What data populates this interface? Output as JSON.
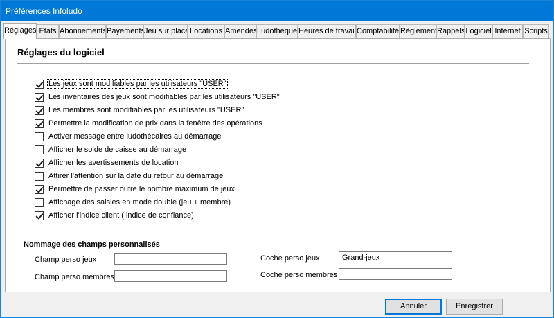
{
  "window": {
    "title": "Préférences Infoludo"
  },
  "tabs": [
    {
      "label": "Réglages",
      "active": true
    },
    {
      "label": "Etats"
    },
    {
      "label": "Abonnements"
    },
    {
      "label": "Payements"
    },
    {
      "label": "Jeu sur place"
    },
    {
      "label": "Locations"
    },
    {
      "label": "Amendes"
    },
    {
      "label": "Ludothèque"
    },
    {
      "label": "Heures de travail"
    },
    {
      "label": "Comptabilité"
    },
    {
      "label": "Règlement"
    },
    {
      "label": "Rappels"
    },
    {
      "label": "Logiciel"
    },
    {
      "label": "Internet"
    },
    {
      "label": "Scripts"
    }
  ],
  "settings": {
    "title": "Réglages du logiciel",
    "options": [
      {
        "label": "Les jeux sont modifiables par les utilisateurs \"USER\"",
        "checked": true
      },
      {
        "label": "Les inventaires des jeux sont modifiables par les utilisateurs \"USER\"",
        "checked": true
      },
      {
        "label": "Les membres sont modifiables par les utilisateurs \"USER\"",
        "checked": true
      },
      {
        "label": "Permettre la modification de prix dans la fenêtre des opérations",
        "checked": true
      },
      {
        "label": "Activer message entre ludothécaires au démarrage",
        "checked": false
      },
      {
        "label": "Afficher le solde de caisse au démarrage",
        "checked": false
      },
      {
        "label": "Afficher les avertissements de location",
        "checked": true
      },
      {
        "label": "Attirer l'attention sur la date du retour au démarrage",
        "checked": false
      },
      {
        "label": "Permettre de passer outre le nombre maximum de jeux",
        "checked": true
      },
      {
        "label": "Affichage des saisies en mode double (jeu + membre)",
        "checked": false
      },
      {
        "label": "Afficher l'indice client ( indice de confiance)",
        "checked": true
      }
    ]
  },
  "custom_fields": {
    "title": "Nommage des champs personnalisés",
    "champ_perso_jeux": {
      "label": "Champ perso jeux",
      "value": ""
    },
    "champ_perso_membres": {
      "label": "Champ perso membres",
      "value": ""
    },
    "coche_perso_jeux": {
      "label": "Coche perso jeux",
      "value": "Grand-jeux"
    },
    "coche_perso_membres": {
      "label": "Coche perso membres",
      "value": ""
    }
  },
  "buttons": {
    "cancel": "Annuler",
    "save": "Enregistrer"
  }
}
